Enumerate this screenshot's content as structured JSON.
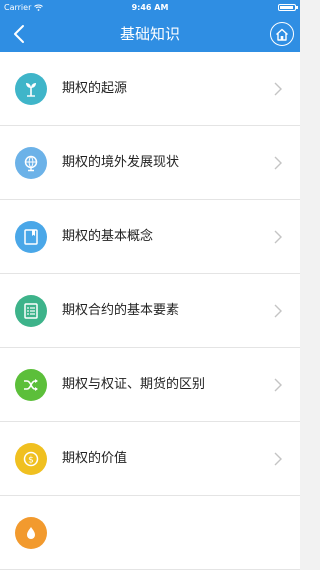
{
  "status_bar": {
    "carrier": "Carrier",
    "time": "9:46 AM"
  },
  "nav": {
    "title": "基础知识",
    "back_icon": "chevron-left-icon",
    "home_icon": "home-icon"
  },
  "accent": "#2f8ee3",
  "items": [
    {
      "label": "期权的起源",
      "icon": "sprout-icon",
      "color": "#3fb5c9"
    },
    {
      "label": "期权的境外发展现状",
      "icon": "globe-icon",
      "color": "#6cb2e8"
    },
    {
      "label": "期权的基本概念",
      "icon": "book-icon",
      "color": "#4aa7e8"
    },
    {
      "label": "期权合约的基本要素",
      "icon": "list-icon",
      "color": "#3db38a"
    },
    {
      "label": "期权与权证、期货的区别",
      "icon": "shuffle-icon",
      "color": "#5cbf3a"
    },
    {
      "label": "期权的价值",
      "icon": "dollar-icon",
      "color": "#f0c020"
    },
    {
      "label": "",
      "icon": "flame-icon",
      "color": "#f29a2e"
    }
  ]
}
